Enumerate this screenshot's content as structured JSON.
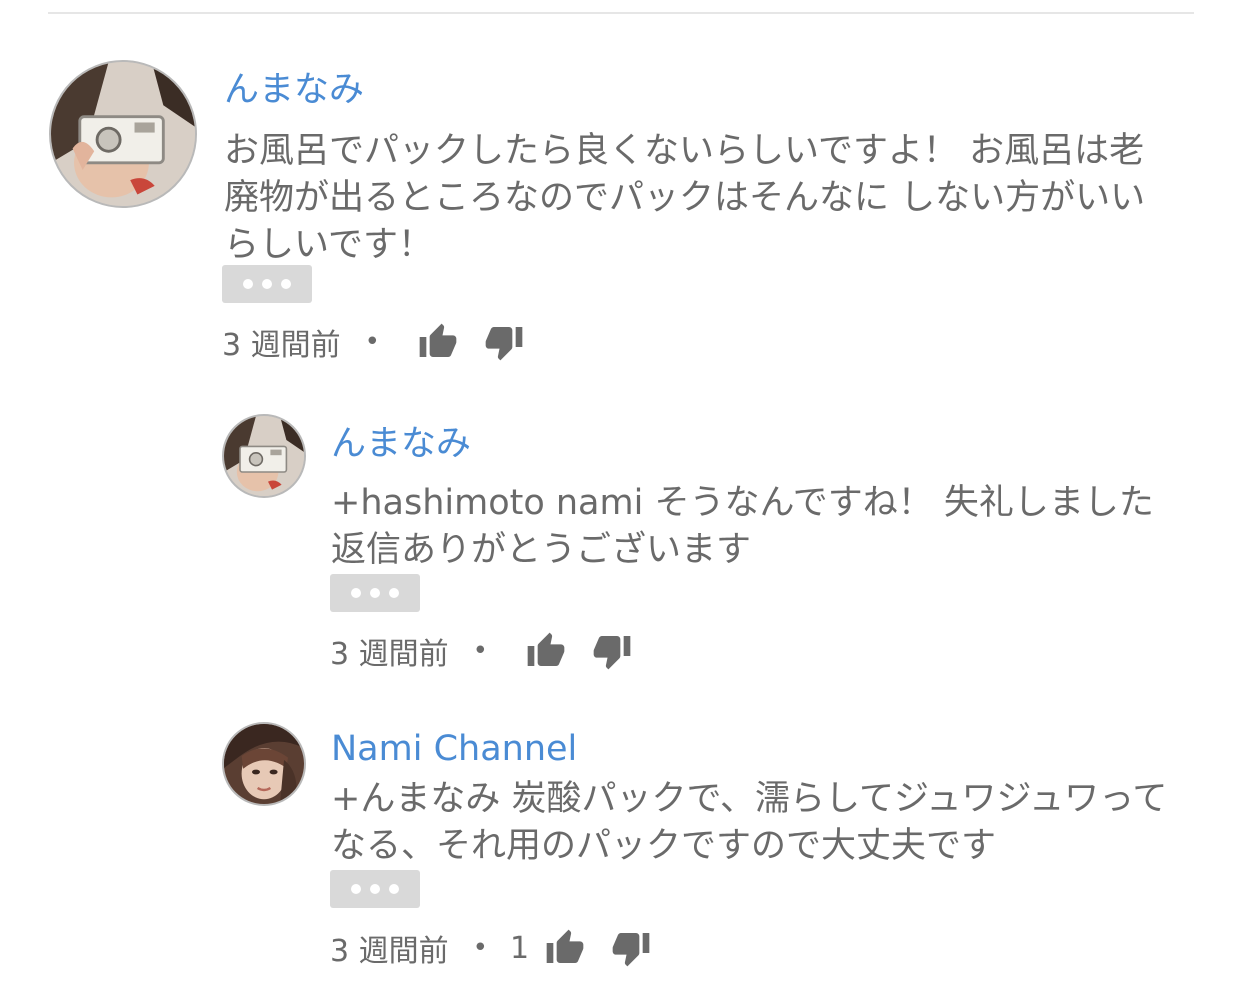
{
  "comments": [
    {
      "author": "んまなみ",
      "text": "お風呂でパックしたら良くないらしいですよ！ お風呂は老廃物が出るところなのでパックはそんなに しない方がいいらしいです！",
      "time": "3 週間前",
      "dot": "•",
      "likes": ""
    },
    {
      "author": "んまなみ",
      "text": "+hashimoto nami そうなんですね！ 失礼しました 返信ありがとうございます",
      "time": "3 週間前",
      "dot": "•",
      "likes": ""
    },
    {
      "author": "Nami Channel",
      "text": "+んまなみ 炭酸パックで、濡らしてジュワジュワってなる、それ用のパックですので大丈夫です",
      "time": "3 週間前",
      "dot": "•",
      "likes": "1"
    }
  ],
  "icons": {
    "more": "more-horizontal-icon",
    "like": "thumb-up-icon",
    "dislike": "thumb-down-icon"
  },
  "colors": {
    "author": "#4a8bd4",
    "text": "#6a6a6a",
    "more_bg": "#d9d9d9",
    "icon": "#6a6a6a"
  }
}
